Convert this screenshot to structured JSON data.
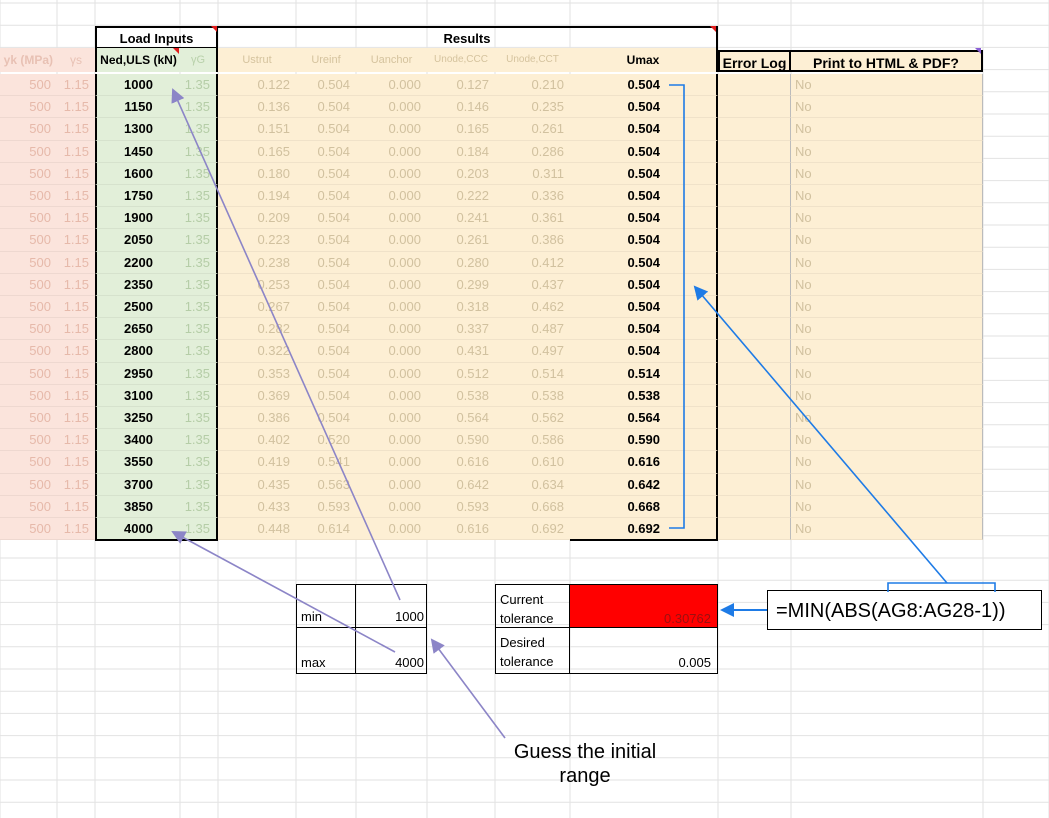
{
  "headers": {
    "load_inputs": "Load Inputs",
    "results": "Results",
    "fyk": "yk (MPa)",
    "gamma_s": "γs",
    "ned": "Ned,ULS (kN)",
    "gamma_g": "γG",
    "ustrut": "Ustrut",
    "ureinf": "Ureinf",
    "uanchor": "Uanchor",
    "unode_ccc": "Unode,CCC",
    "unode_cct": "Unode,CCT",
    "umax": "Umax",
    "error_log": "Error Log",
    "print": "Print to HTML & PDF?"
  },
  "rows": [
    {
      "fyk": "500",
      "gs": "1.15",
      "ned": "1000",
      "gg": "1.35",
      "ustrut": "0.122",
      "ureinf": "0.504",
      "uanchor": "0.000",
      "uccc": "0.127",
      "ucct": "0.210",
      "umax": "0.504",
      "print": "No"
    },
    {
      "fyk": "500",
      "gs": "1.15",
      "ned": "1150",
      "gg": "1.35",
      "ustrut": "0.136",
      "ureinf": "0.504",
      "uanchor": "0.000",
      "uccc": "0.146",
      "ucct": "0.235",
      "umax": "0.504",
      "print": "No"
    },
    {
      "fyk": "500",
      "gs": "1.15",
      "ned": "1300",
      "gg": "1.35",
      "ustrut": "0.151",
      "ureinf": "0.504",
      "uanchor": "0.000",
      "uccc": "0.165",
      "ucct": "0.261",
      "umax": "0.504",
      "print": "No"
    },
    {
      "fyk": "500",
      "gs": "1.15",
      "ned": "1450",
      "gg": "1.35",
      "ustrut": "0.165",
      "ureinf": "0.504",
      "uanchor": "0.000",
      "uccc": "0.184",
      "ucct": "0.286",
      "umax": "0.504",
      "print": "No"
    },
    {
      "fyk": "500",
      "gs": "1.15",
      "ned": "1600",
      "gg": "1.35",
      "ustrut": "0.180",
      "ureinf": "0.504",
      "uanchor": "0.000",
      "uccc": "0.203",
      "ucct": "0.311",
      "umax": "0.504",
      "print": "No"
    },
    {
      "fyk": "500",
      "gs": "1.15",
      "ned": "1750",
      "gg": "1.35",
      "ustrut": "0.194",
      "ureinf": "0.504",
      "uanchor": "0.000",
      "uccc": "0.222",
      "ucct": "0.336",
      "umax": "0.504",
      "print": "No"
    },
    {
      "fyk": "500",
      "gs": "1.15",
      "ned": "1900",
      "gg": "1.35",
      "ustrut": "0.209",
      "ureinf": "0.504",
      "uanchor": "0.000",
      "uccc": "0.241",
      "ucct": "0.361",
      "umax": "0.504",
      "print": "No"
    },
    {
      "fyk": "500",
      "gs": "1.15",
      "ned": "2050",
      "gg": "1.35",
      "ustrut": "0.223",
      "ureinf": "0.504",
      "uanchor": "0.000",
      "uccc": "0.261",
      "ucct": "0.386",
      "umax": "0.504",
      "print": "No"
    },
    {
      "fyk": "500",
      "gs": "1.15",
      "ned": "2200",
      "gg": "1.35",
      "ustrut": "0.238",
      "ureinf": "0.504",
      "uanchor": "0.000",
      "uccc": "0.280",
      "ucct": "0.412",
      "umax": "0.504",
      "print": "No"
    },
    {
      "fyk": "500",
      "gs": "1.15",
      "ned": "2350",
      "gg": "1.35",
      "ustrut": "0.253",
      "ureinf": "0.504",
      "uanchor": "0.000",
      "uccc": "0.299",
      "ucct": "0.437",
      "umax": "0.504",
      "print": "No"
    },
    {
      "fyk": "500",
      "gs": "1.15",
      "ned": "2500",
      "gg": "1.35",
      "ustrut": "0.267",
      "ureinf": "0.504",
      "uanchor": "0.000",
      "uccc": "0.318",
      "ucct": "0.462",
      "umax": "0.504",
      "print": "No"
    },
    {
      "fyk": "500",
      "gs": "1.15",
      "ned": "2650",
      "gg": "1.35",
      "ustrut": "0.282",
      "ureinf": "0.504",
      "uanchor": "0.000",
      "uccc": "0.337",
      "ucct": "0.487",
      "umax": "0.504",
      "print": "No"
    },
    {
      "fyk": "500",
      "gs": "1.15",
      "ned": "2800",
      "gg": "1.35",
      "ustrut": "0.322",
      "ureinf": "0.504",
      "uanchor": "0.000",
      "uccc": "0.431",
      "ucct": "0.497",
      "umax": "0.504",
      "print": "No"
    },
    {
      "fyk": "500",
      "gs": "1.15",
      "ned": "2950",
      "gg": "1.35",
      "ustrut": "0.353",
      "ureinf": "0.504",
      "uanchor": "0.000",
      "uccc": "0.512",
      "ucct": "0.514",
      "umax": "0.514",
      "print": "No"
    },
    {
      "fyk": "500",
      "gs": "1.15",
      "ned": "3100",
      "gg": "1.35",
      "ustrut": "0.369",
      "ureinf": "0.504",
      "uanchor": "0.000",
      "uccc": "0.538",
      "ucct": "0.538",
      "umax": "0.538",
      "print": "No"
    },
    {
      "fyk": "500",
      "gs": "1.15",
      "ned": "3250",
      "gg": "1.35",
      "ustrut": "0.386",
      "ureinf": "0.504",
      "uanchor": "0.000",
      "uccc": "0.564",
      "ucct": "0.562",
      "umax": "0.564",
      "print": "No"
    },
    {
      "fyk": "500",
      "gs": "1.15",
      "ned": "3400",
      "gg": "1.35",
      "ustrut": "0.402",
      "ureinf": "0.520",
      "uanchor": "0.000",
      "uccc": "0.590",
      "ucct": "0.586",
      "umax": "0.590",
      "print": "No"
    },
    {
      "fyk": "500",
      "gs": "1.15",
      "ned": "3550",
      "gg": "1.35",
      "ustrut": "0.419",
      "ureinf": "0.541",
      "uanchor": "0.000",
      "uccc": "0.616",
      "ucct": "0.610",
      "umax": "0.616",
      "print": "No"
    },
    {
      "fyk": "500",
      "gs": "1.15",
      "ned": "3700",
      "gg": "1.35",
      "ustrut": "0.435",
      "ureinf": "0.563",
      "uanchor": "0.000",
      "uccc": "0.642",
      "ucct": "0.634",
      "umax": "0.642",
      "print": "No"
    },
    {
      "fyk": "500",
      "gs": "1.15",
      "ned": "3850",
      "gg": "1.35",
      "ustrut": "0.433",
      "ureinf": "0.593",
      "uanchor": "0.000",
      "uccc": "0.593",
      "ucct": "0.668",
      "umax": "0.668",
      "print": "No"
    },
    {
      "fyk": "500",
      "gs": "1.15",
      "ned": "4000",
      "gg": "1.35",
      "ustrut": "0.448",
      "ureinf": "0.614",
      "uanchor": "0.000",
      "uccc": "0.616",
      "ucct": "0.692",
      "umax": "0.692",
      "print": "No"
    }
  ],
  "range_box": {
    "min_label": "min",
    "min_value": "1000",
    "max_label": "max",
    "max_value": "4000"
  },
  "tolerance_box": {
    "current_label_1": "Current",
    "current_label_2": "tolerance",
    "current_value": "0.30762",
    "desired_label_1": "Desired",
    "desired_label_2": "tolerance",
    "desired_value": "0.005"
  },
  "annotations": {
    "formula": "=MIN(ABS(AG8:AG28-1))",
    "guess_line_1": "Guess the initial",
    "guess_line_2": "range"
  },
  "colors": {
    "pink_fill": "#fbe4dc",
    "green_fill": "#e2efd9",
    "tan_fill": "#fdefd4",
    "red_fill": "#ff0000",
    "blue_arrow": "#1e7be6",
    "purple_arrow": "#8c85c7",
    "grid": "#d9d9d9"
  }
}
